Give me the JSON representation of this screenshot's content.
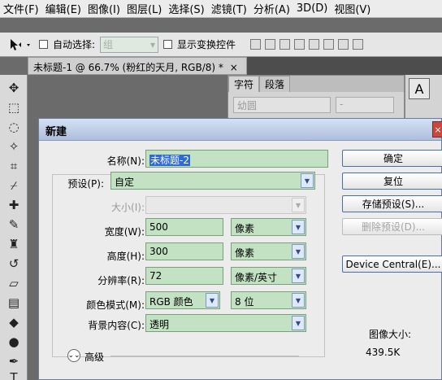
{
  "menubar": {
    "items": [
      "文件(F)",
      "编辑(E)",
      "图像(I)",
      "图层(L)",
      "选择(S)",
      "滤镜(T)",
      "分析(A)",
      "3D(D)",
      "视图(V)"
    ]
  },
  "options": {
    "auto_select_label": "自动选择:",
    "auto_select_value": "组",
    "show_transform_label": "显示变换控件"
  },
  "document": {
    "tab_title": "未标题-1 @ 66.7% (粉红的天月, RGB/8) *",
    "close_glyph": "×"
  },
  "char_panel": {
    "tabs": [
      "字符",
      "段落"
    ],
    "font_value": "幼圆",
    "style_value": "-",
    "aa_glyph": "A"
  },
  "dialog": {
    "title": "新建",
    "name_label": "名称(N):",
    "name_value": "未标题-2",
    "preset_label": "预设(P):",
    "preset_value": "自定",
    "size_label": "大小(I):",
    "width_label": "宽度(W):",
    "width_value": "500",
    "width_unit": "像素",
    "height_label": "高度(H):",
    "height_value": "300",
    "height_unit": "像素",
    "resolution_label": "分辨率(R):",
    "resolution_value": "72",
    "resolution_unit": "像素/英寸",
    "color_mode_label": "颜色模式(M):",
    "color_mode_value": "RGB 颜色",
    "bit_depth_value": "8 位",
    "background_label": "背景内容(C):",
    "background_value": "透明",
    "advanced_label": "高级",
    "ok_button": "确定",
    "reset_button": "复位",
    "save_preset_button": "存储预设(S)...",
    "delete_preset_button": "删除预设(D)...",
    "device_central_button": "Device Central(E)...",
    "image_size_label": "图像大小:",
    "image_size_value": "439.5K",
    "close_glyph": "×"
  }
}
